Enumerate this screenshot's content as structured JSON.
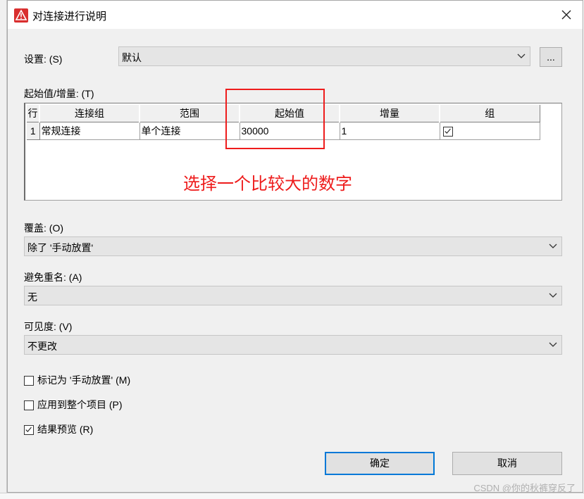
{
  "window": {
    "title": "对连接进行说明"
  },
  "settings": {
    "label": "设置: (S)",
    "value": "默认",
    "more_button": "..."
  },
  "start_increment": {
    "label": "起始值/增量: (T)",
    "columns": [
      "行",
      "连接组",
      "范围",
      "起始值",
      "增量",
      "组"
    ],
    "rows": [
      {
        "row": "1",
        "group": "常规连接",
        "scope": "单个连接",
        "start": "30000",
        "increment": "1",
        "grouped": true
      }
    ]
  },
  "annotation": {
    "text": "选择一个比较大的数字",
    "color": "#ee1c1c"
  },
  "overwrite": {
    "label": "覆盖: (O)",
    "value": "除了 '手动放置'"
  },
  "avoid_duplicate": {
    "label": "避免重名: (A)",
    "value": "无"
  },
  "visibility": {
    "label": "可见度: (V)",
    "value": "不更改"
  },
  "options": [
    {
      "label": "标记为 '手动放置' (M)",
      "checked": false
    },
    {
      "label": "应用到整个项目 (P)",
      "checked": false
    },
    {
      "label": "结果预览 (R)",
      "checked": true
    }
  ],
  "buttons": {
    "ok": "确定",
    "cancel": "取消"
  },
  "watermark": "CSDN @你的秋裤穿反了",
  "colors": {
    "accent": "#0078d7",
    "annotation": "#ee1c1c",
    "app_icon": "#d92f2f"
  }
}
